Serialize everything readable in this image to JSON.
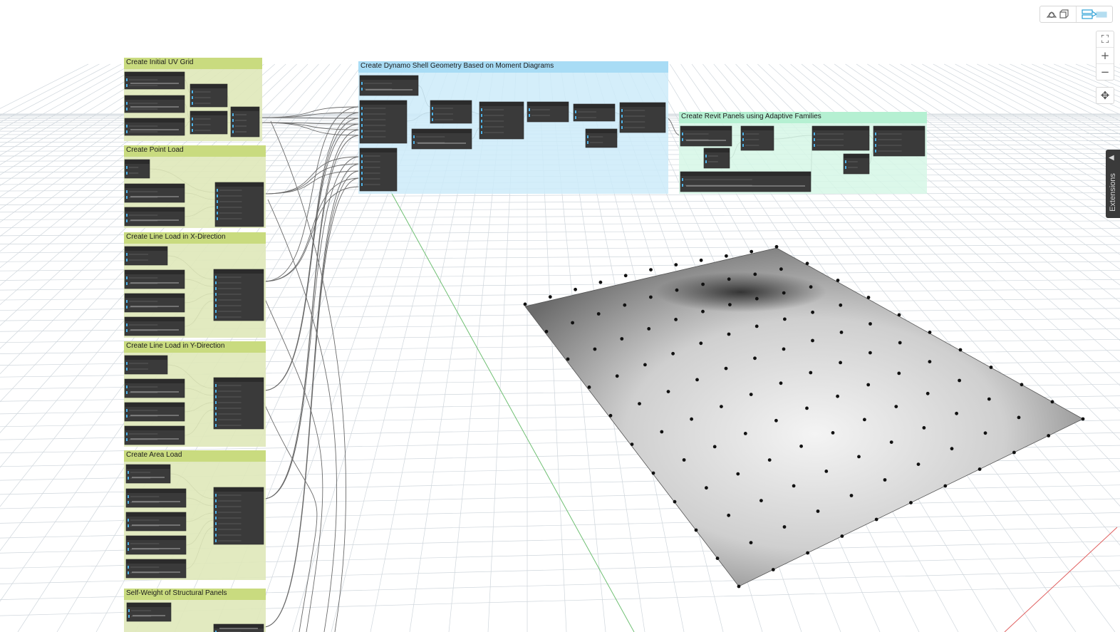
{
  "groups": [
    {
      "id": "uv",
      "title": "Create Initial UV Grid"
    },
    {
      "id": "point",
      "title": "Create Point Load"
    },
    {
      "id": "linex",
      "title": "Create Line Load in X-Direction"
    },
    {
      "id": "liney",
      "title": "Create Line Load in Y-Direction"
    },
    {
      "id": "area",
      "title": "Create Area Load"
    },
    {
      "id": "self",
      "title": "Self-Weight of Structural Panels"
    },
    {
      "id": "shell",
      "title": "Create Dynamo Shell Geometry Based on Moment Diagrams"
    },
    {
      "id": "revit",
      "title": "Create Revit Panels using Adaptive Families"
    }
  ],
  "extensions": {
    "label": "Extensions"
  },
  "colors": {
    "group_green": "#dfe8b9",
    "group_green_head": "#c9db7f",
    "group_blue": "#cdebf9",
    "group_blue_head": "#a8dcf5",
    "group_mint": "#d6f7e6",
    "group_mint_head": "#b5f0d2",
    "node": "#3a3a3a",
    "accent": "#2a9fd6"
  },
  "icons": [
    "geometry-view-icon",
    "graph-view-icon",
    "zoom-fit-icon",
    "zoom-in-icon",
    "zoom-out-icon",
    "pan-icon",
    "chevron-left-icon"
  ]
}
